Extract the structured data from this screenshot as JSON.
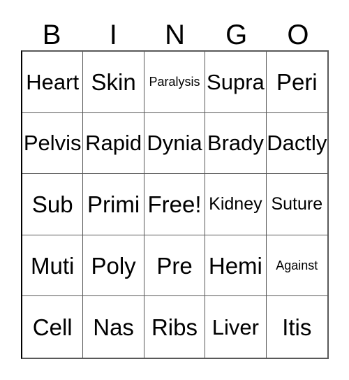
{
  "card": {
    "title": "BINGO",
    "header_letters": [
      "B",
      "I",
      "N",
      "G",
      "O"
    ],
    "free_space_label": "Free!",
    "colors": {
      "background": "#ffffff",
      "grid_line": "#595959",
      "text": "#000000"
    },
    "rows": [
      [
        {
          "label": "Heart",
          "size": "lg"
        },
        {
          "label": "Skin",
          "size": "xl"
        },
        {
          "label": "Paralysis",
          "size": "sm"
        },
        {
          "label": "Supra",
          "size": "lg"
        },
        {
          "label": "Peri",
          "size": "xl"
        }
      ],
      [
        {
          "label": "Pelvis",
          "size": "lg"
        },
        {
          "label": "Rapid",
          "size": "lg"
        },
        {
          "label": "Dynia",
          "size": "lg"
        },
        {
          "label": "Brady",
          "size": "lg"
        },
        {
          "label": "Dactly",
          "size": "lg"
        }
      ],
      [
        {
          "label": "Sub",
          "size": "xl"
        },
        {
          "label": "Primi",
          "size": "xl"
        },
        {
          "label": "Free!",
          "size": "xl"
        },
        {
          "label": "Kidney",
          "size": "md"
        },
        {
          "label": "Suture",
          "size": "md"
        }
      ],
      [
        {
          "label": "Muti",
          "size": "xl"
        },
        {
          "label": "Poly",
          "size": "xl"
        },
        {
          "label": "Pre",
          "size": "xl"
        },
        {
          "label": "Hemi",
          "size": "xl"
        },
        {
          "label": "Against",
          "size": "sm"
        }
      ],
      [
        {
          "label": "Cell",
          "size": "xl"
        },
        {
          "label": "Nas",
          "size": "xl"
        },
        {
          "label": "Ribs",
          "size": "xl"
        },
        {
          "label": "Liver",
          "size": "lg"
        },
        {
          "label": "Itis",
          "size": "xl"
        }
      ]
    ]
  }
}
